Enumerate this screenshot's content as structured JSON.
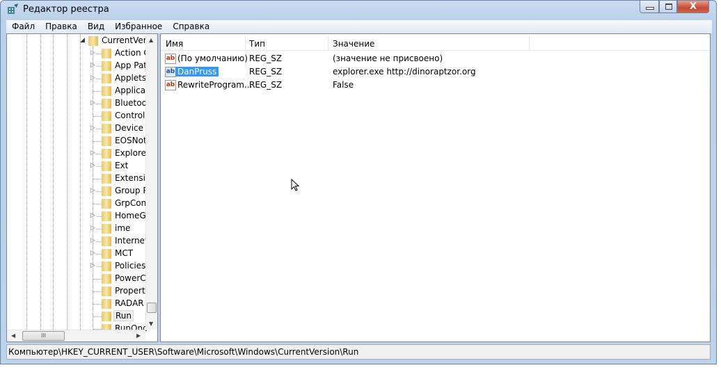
{
  "window": {
    "title": "Редактор реестра",
    "controls": {
      "close": "X"
    }
  },
  "menu": [
    "Файл",
    "Правка",
    "Вид",
    "Избранное",
    "Справка"
  ],
  "tree": {
    "root": "CurrentVers",
    "items": [
      {
        "label": "Action C",
        "expandable": true
      },
      {
        "label": "App Pat",
        "expandable": true
      },
      {
        "label": "Applets",
        "expandable": true
      },
      {
        "label": "Applicat",
        "expandable": false
      },
      {
        "label": "Bluetoo",
        "expandable": true
      },
      {
        "label": "Controls",
        "expandable": false
      },
      {
        "label": "Device M",
        "expandable": true
      },
      {
        "label": "EOSNot",
        "expandable": false
      },
      {
        "label": "Explorer",
        "expandable": true
      },
      {
        "label": "Ext",
        "expandable": true
      },
      {
        "label": "Extensio",
        "expandable": false
      },
      {
        "label": "Group P",
        "expandable": true
      },
      {
        "label": "GrpCon",
        "expandable": false
      },
      {
        "label": "HomeG",
        "expandable": true
      },
      {
        "label": "ime",
        "expandable": true
      },
      {
        "label": "Internet",
        "expandable": true
      },
      {
        "label": "MCT",
        "expandable": true
      },
      {
        "label": "Policies",
        "expandable": true
      },
      {
        "label": "PowerC",
        "expandable": false
      },
      {
        "label": "Property",
        "expandable": false
      },
      {
        "label": "RADAR",
        "expandable": false
      },
      {
        "label": "Run",
        "expandable": false,
        "selected": true
      },
      {
        "label": "RunOnc",
        "expandable": false
      }
    ],
    "hscroll_grip": "III"
  },
  "list": {
    "columns": [
      "Имя",
      "Тип",
      "Значение"
    ],
    "rows": [
      {
        "name": "(По умолчанию)",
        "type": "REG_SZ",
        "value": "(значение не присвоено)",
        "icon": "string-value-icon"
      },
      {
        "name": "DanPruss",
        "type": "REG_SZ",
        "value": "explorer.exe http://dinoraptzor.org",
        "icon": "string-value-icon",
        "selected": true
      },
      {
        "name": "RewriteProgram...",
        "type": "REG_SZ",
        "value": "False",
        "icon": "string-value-icon"
      }
    ],
    "icon_text": "ab"
  },
  "status": "Компьютер\\HKEY_CURRENT_USER\\Software\\Microsoft\\Windows\\CurrentVersion\\Run",
  "colors": {
    "selection": "#3399ff",
    "close": "#c74a32"
  }
}
